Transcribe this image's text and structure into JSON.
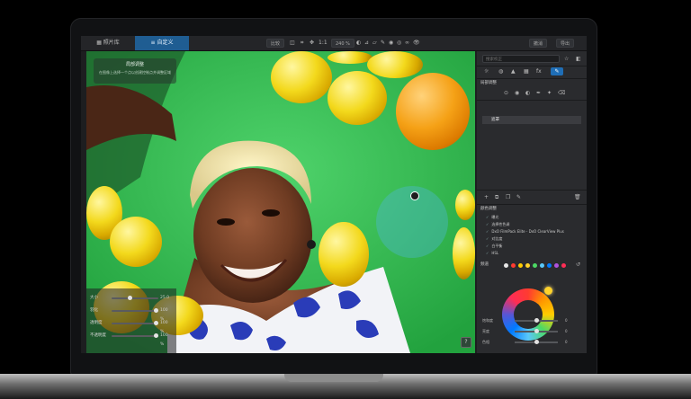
{
  "tabs": [
    {
      "label": "照片库"
    },
    {
      "label": "自定义"
    }
  ],
  "toolbar": {
    "compare_label": "比较",
    "zoom": "240 %",
    "actual_size_label": "1:1",
    "undo_label": "撤消",
    "export_label": "导出"
  },
  "tip": {
    "title": "局部调整",
    "text": "在图像上选择一个点以创建控制点并调整区域"
  },
  "adjust_panel": [
    {
      "label": "大小",
      "value": "25.0"
    },
    {
      "label": "羽化",
      "value": "100 %"
    },
    {
      "label": "透明度",
      "value": "100 %"
    },
    {
      "label": "不透明度",
      "value": "100 %"
    }
  ],
  "help_label": "?",
  "panel": {
    "search_placeholder": "搜索校正",
    "section_title": "局部调整",
    "mask_item": "遮罩",
    "list_title": "颜色调整",
    "items": [
      {
        "label": "曝光"
      },
      {
        "label": "选择性色调"
      },
      {
        "label": "DxO FilmPack Elite - DxO ClearView Plus"
      },
      {
        "label": "对比度"
      },
      {
        "label": "白平衡"
      },
      {
        "label": "HSL"
      }
    ],
    "swatch_label": "频道",
    "swatches": [
      "#e8e8e8",
      "#ff3b30",
      "#ffcc00",
      "#ffd22b",
      "#4cd964",
      "#5ac8fa",
      "#007aff",
      "#af52de",
      "#ff2d55"
    ],
    "sliders": [
      {
        "label": "饱和度",
        "value": "0",
        "pos": 0.5
      },
      {
        "label": "亮度",
        "value": "0",
        "pos": 0.5
      },
      {
        "label": "色相",
        "value": "0",
        "pos": 0.5
      }
    ]
  }
}
